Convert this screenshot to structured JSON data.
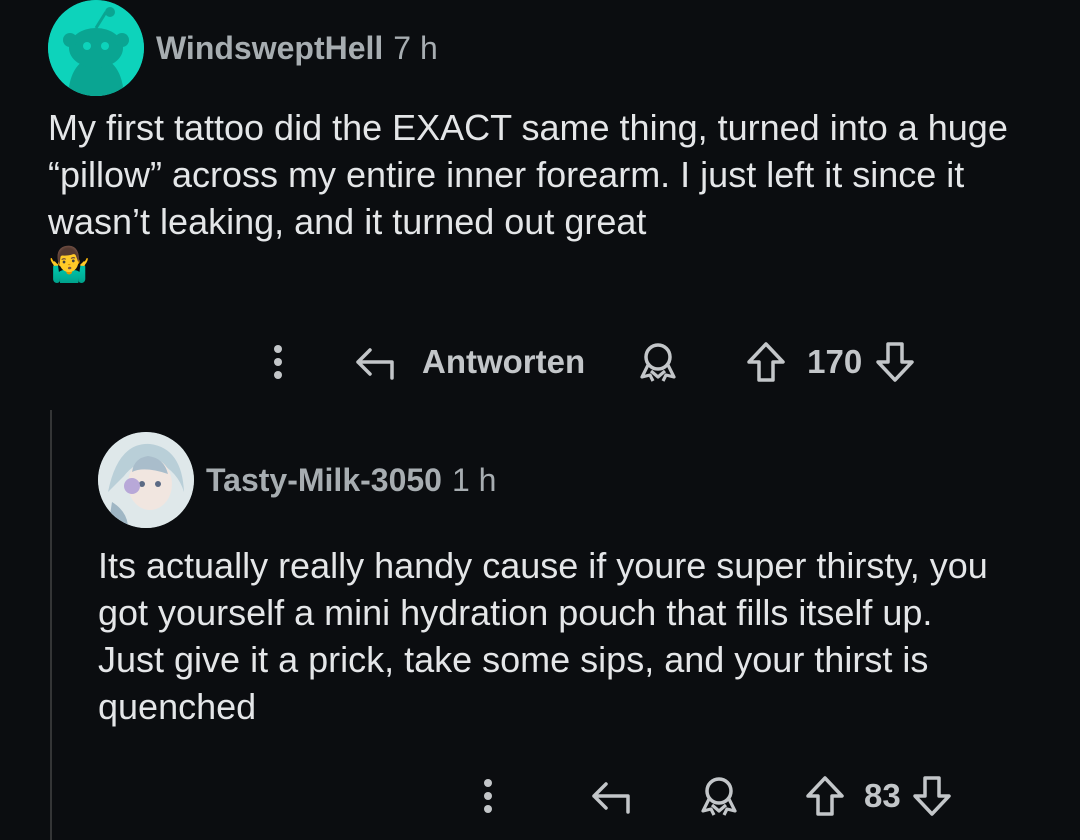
{
  "comments": [
    {
      "username": "WindsweptHell",
      "time": "7 h",
      "text": "My first tattoo did the EXACT same thing, turned into a huge “pillow” across my entire inner forearm. I just left it since it wasn’t leaking, and it turned out great",
      "emoji": "🤷‍♂️",
      "reply_label": "Antworten",
      "votes": "170",
      "avatar_color": "#0dd3bb"
    },
    {
      "username": "Tasty-Milk-3050",
      "time": "1 h",
      "text": "Its actually really handy cause if youre super thirsty, you got yourself a mini hydration pouch that fills itself up. Just give it a prick, take some sips, and your thirst is quenched",
      "votes": "83"
    }
  ],
  "icons": [
    "more-icon",
    "reply-icon",
    "award-icon",
    "upvote-icon",
    "downvote-icon"
  ],
  "colors": {
    "background": "#0b0d10",
    "text": "#e4e6e8",
    "meta": "#a7adb1"
  }
}
